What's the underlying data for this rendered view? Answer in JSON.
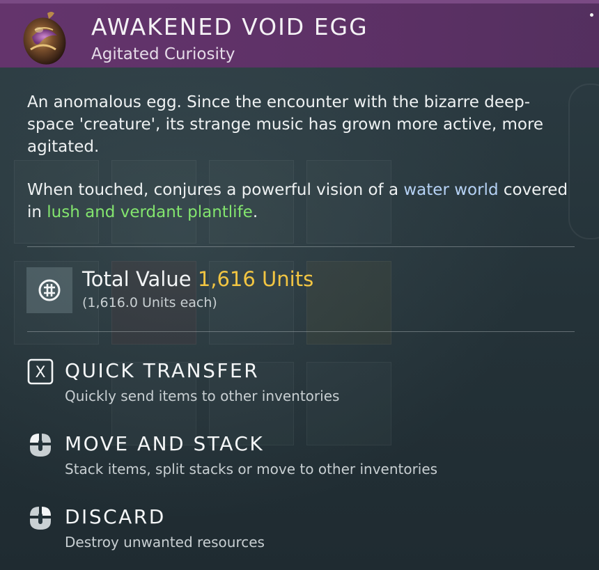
{
  "item": {
    "name": "AWAKENED VOID EGG",
    "subtitle": "Agitated Curiosity",
    "icon": "void-egg-icon"
  },
  "description": {
    "paragraph1": "An anomalous egg. Since the encounter with the bizarre deep-space 'creature', its strange music has grown more active, more agitated.",
    "p2_part1": "When touched, conjures a powerful vision of a ",
    "p2_highlight1": "water world",
    "p2_part2": " covered in ",
    "p2_highlight2": "lush and verdant plantlife",
    "p2_part3": "."
  },
  "value": {
    "label": "Total Value",
    "amount": "1,616 Units",
    "each": "(1,616.0 Units each)",
    "icon": "units-currency-icon"
  },
  "actions": [
    {
      "title": "QUICK TRANSFER",
      "description": "Quickly send items to other inventories",
      "icon": "x-key-icon",
      "key": "X"
    },
    {
      "title": "MOVE AND STACK",
      "description": "Stack items, split stacks or move to other inventories",
      "icon": "mouse-left-click-icon"
    },
    {
      "title": "DISCARD",
      "description": "Destroy unwanted resources",
      "icon": "mouse-right-click-icon"
    }
  ],
  "colors": {
    "header": "#66346e",
    "units": "#f2c542",
    "water_world": "#b6d2f5",
    "plantlife": "#83e56e"
  }
}
